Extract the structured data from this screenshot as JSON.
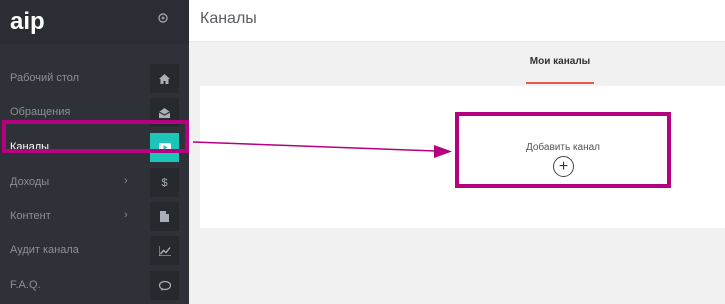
{
  "app": {
    "logo_text": "aip",
    "colors": {
      "sidebar_bg": "#2e3238",
      "accent_active": "#1bc6b8",
      "tab_underline": "#e8594b",
      "highlight": "#b5007f"
    }
  },
  "sidebar": {
    "settings_icon": "gear-icon",
    "items": [
      {
        "label": "Рабочий стол",
        "icon": "home-icon",
        "has_chevron": false,
        "active": false
      },
      {
        "label": "Обращения",
        "icon": "inbox-icon",
        "has_chevron": false,
        "active": false
      },
      {
        "label": "Каналы",
        "icon": "youtube-icon",
        "has_chevron": false,
        "active": true
      },
      {
        "label": "Доходы",
        "icon": "dollar-icon",
        "has_chevron": true,
        "chevron": "›",
        "active": false
      },
      {
        "label": "Контент",
        "icon": "document-icon",
        "has_chevron": true,
        "chevron": "›",
        "active": false
      },
      {
        "label": "Аудит канала",
        "icon": "chart-icon",
        "has_chevron": false,
        "active": false
      },
      {
        "label": "F.A.Q.",
        "icon": "chat-icon",
        "has_chevron": false,
        "active": false
      }
    ]
  },
  "header": {
    "title": "Каналы"
  },
  "tabs": [
    {
      "label": "Мои каналы",
      "active": true
    }
  ],
  "main": {
    "add_channel_label": "Добавить канал",
    "add_channel_symbol": "+"
  }
}
